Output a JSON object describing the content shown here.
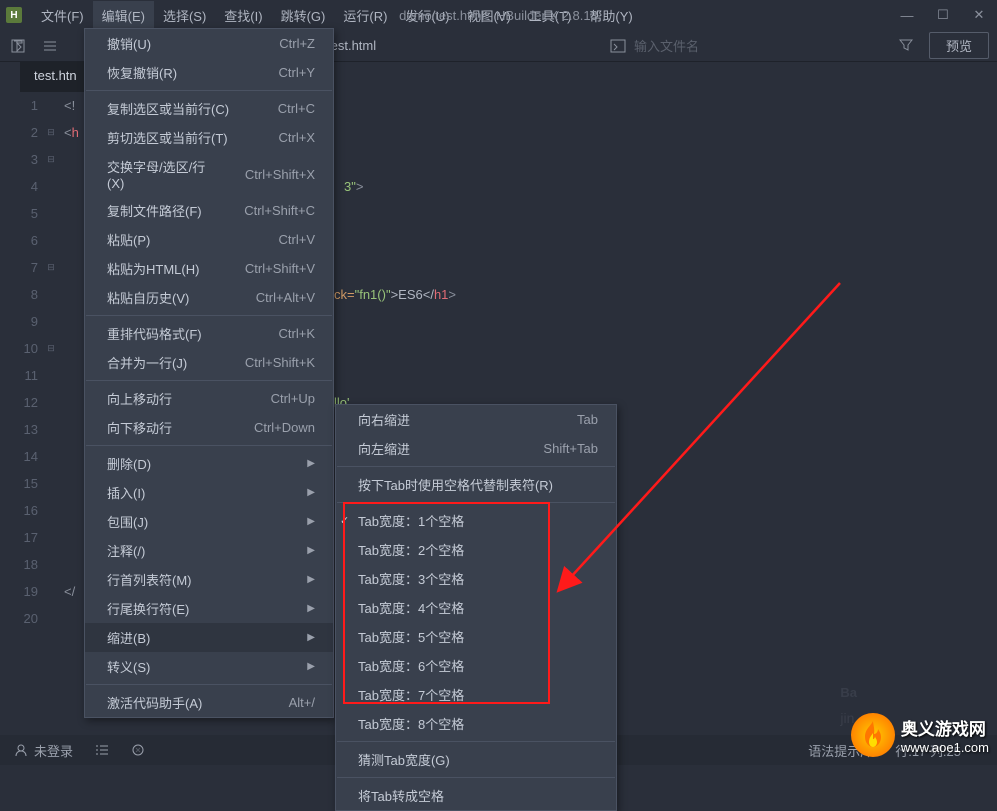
{
  "titlebar": {
    "menus": [
      "文件(F)",
      "编辑(E)",
      "选择(S)",
      "查找(I)",
      "跳转(G)",
      "运行(R)",
      "发行(U)",
      "视图(V)",
      "工具(T)",
      "帮助(Y)"
    ],
    "title": "demo/test.html - HBuilder X 2.8.13"
  },
  "toolbar": {
    "breadcrumb_item": "test.html",
    "search_placeholder": "输入文件名",
    "preview": "预览"
  },
  "tab": {
    "name": "test.htn"
  },
  "dropdown_main": [
    {
      "label": "撤销(U)",
      "short": "Ctrl+Z"
    },
    {
      "label": "恢复撤销(R)",
      "short": "Ctrl+Y"
    },
    {
      "sep": true
    },
    {
      "label": "复制选区或当前行(C)",
      "short": "Ctrl+C"
    },
    {
      "label": "剪切选区或当前行(T)",
      "short": "Ctrl+X"
    },
    {
      "label": "交换字母/选区/行(X)",
      "short": "Ctrl+Shift+X"
    },
    {
      "label": "复制文件路径(F)",
      "short": "Ctrl+Shift+C"
    },
    {
      "label": "粘贴(P)",
      "short": "Ctrl+V"
    },
    {
      "label": "粘贴为HTML(H)",
      "short": "Ctrl+Shift+V"
    },
    {
      "label": "粘贴自历史(V)",
      "short": "Ctrl+Alt+V"
    },
    {
      "sep": true
    },
    {
      "label": "重排代码格式(F)",
      "short": "Ctrl+K"
    },
    {
      "label": "合并为一行(J)",
      "short": "Ctrl+Shift+K"
    },
    {
      "sep": true
    },
    {
      "label": "向上移动行",
      "short": "Ctrl+Up"
    },
    {
      "label": "向下移动行",
      "short": "Ctrl+Down"
    },
    {
      "sep": true
    },
    {
      "label": "删除(D)",
      "arrow": true
    },
    {
      "label": "插入(I)",
      "arrow": true
    },
    {
      "label": "包围(J)",
      "arrow": true
    },
    {
      "label": "注释(/)",
      "arrow": true
    },
    {
      "label": "行首列表符(M)",
      "arrow": true
    },
    {
      "label": "行尾换行符(E)",
      "arrow": true
    },
    {
      "label": "缩进(B)",
      "arrow": true,
      "hover": true
    },
    {
      "label": "转义(S)",
      "arrow": true
    },
    {
      "sep": true
    },
    {
      "label": "激活代码助手(A)",
      "short": "Alt+/"
    }
  ],
  "dropdown_sub": [
    {
      "label": "向右缩进",
      "short": "Tab"
    },
    {
      "label": "向左缩进",
      "short": "Shift+Tab"
    },
    {
      "sep": true
    },
    {
      "label": "按下Tab时使用空格代替制表符(R)"
    },
    {
      "sep": true
    },
    {
      "label": "Tab宽度：1个空格",
      "check": true
    },
    {
      "label": "Tab宽度：2个空格"
    },
    {
      "label": "Tab宽度：3个空格"
    },
    {
      "label": "Tab宽度：4个空格"
    },
    {
      "label": "Tab宽度：5个空格"
    },
    {
      "label": "Tab宽度：6个空格"
    },
    {
      "label": "Tab宽度：7个空格"
    },
    {
      "label": "Tab宽度：8个空格"
    },
    {
      "sep": true
    },
    {
      "label": "猜测Tab宽度(G)"
    },
    {
      "sep": true
    },
    {
      "label": "将Tab转成空格"
    }
  ],
  "code": {
    "click_attr": "ck=",
    "fn_val": "\"fn1()\"",
    "es6": ">ES6</",
    "tag_close": ">",
    "charset_str": "3\"",
    "hello": "llo'",
    "end_slash": "</"
  },
  "status": {
    "login": "未登录",
    "hint": "语法提示库",
    "pos": "行:17  列:25"
  },
  "watermark": {
    "baidu": "Ba",
    "jing": "jin",
    "name": "奥义游戏网",
    "url": "www.aoe1.com"
  }
}
